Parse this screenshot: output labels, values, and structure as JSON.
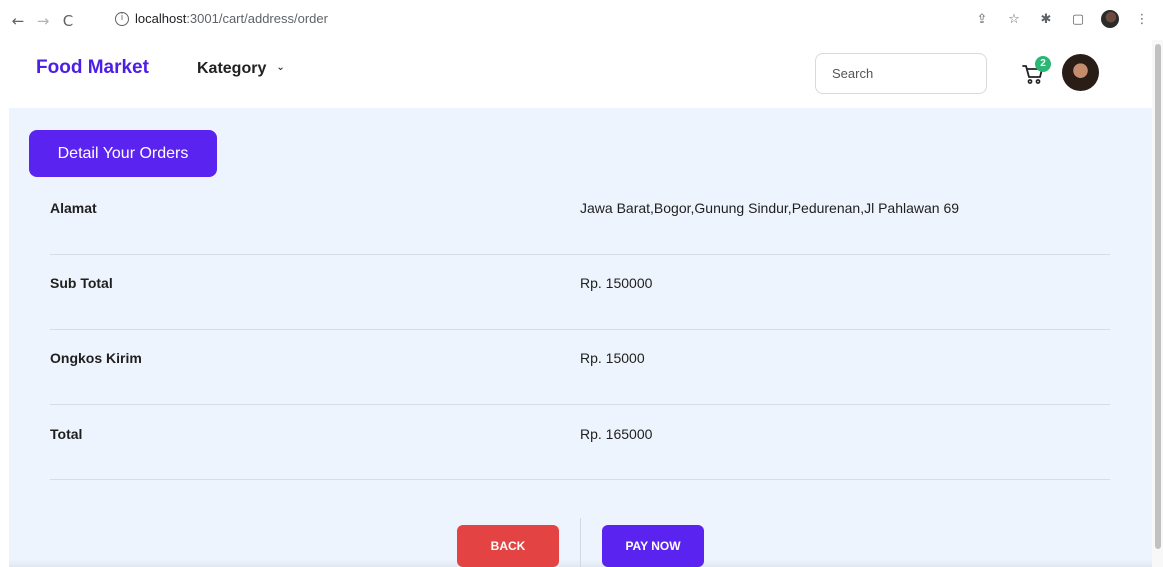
{
  "browser": {
    "url_host": "localhost",
    "url_path": ":3001/cart/address/order",
    "icons": [
      "back-arrow-icon",
      "forward-arrow-icon",
      "reload-icon",
      "info-icon",
      "share-icon",
      "star-icon",
      "extensions-icon",
      "sidebar-icon",
      "profile-icon",
      "kebab-menu-icon"
    ]
  },
  "navbar": {
    "brand": "Food Market",
    "category_label": "Kategory",
    "search_placeholder": "Search",
    "cart_count": "2"
  },
  "order": {
    "title_button": "Detail Your Orders",
    "rows": [
      {
        "label": "Alamat",
        "value": "Jawa Barat,Bogor,Gunung Sindur,Pedurenan,Jl Pahlawan 69"
      },
      {
        "label": "Sub Total",
        "value": "Rp. 150000"
      },
      {
        "label": "Ongkos Kirim",
        "value": "Rp. 15000"
      },
      {
        "label": "Total",
        "value": "Rp. 165000"
      }
    ]
  },
  "actions": {
    "back_label": "BACK",
    "pay_label": "PAY NOW"
  },
  "colors": {
    "brand": "#4c1ee6",
    "primary": "#5a23f0",
    "danger": "#e34443",
    "content_bg": "#eef4fd",
    "badge": "#2bb673"
  }
}
